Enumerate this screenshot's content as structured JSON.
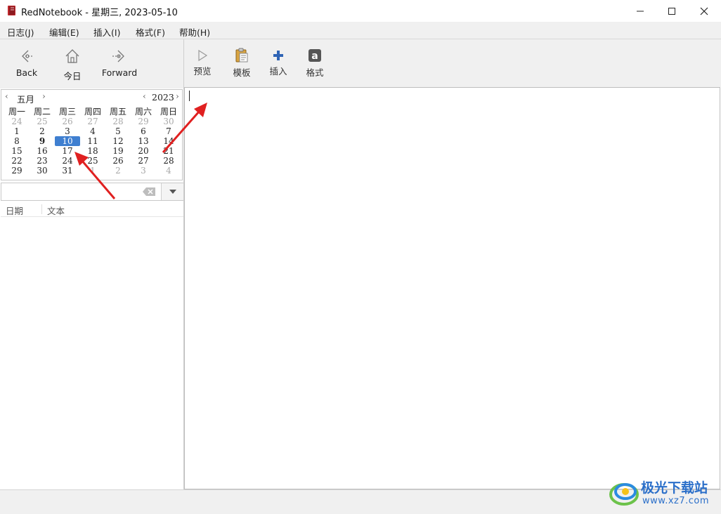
{
  "window": {
    "title": "RedNotebook - 星期三, 2023-05-10",
    "minimize_icon": "minimize-icon",
    "maximize_icon": "maximize-icon",
    "close_icon": "close-icon"
  },
  "menu": [
    {
      "label": "日志(J)"
    },
    {
      "label": "编辑(E)"
    },
    {
      "label": "插入(I)"
    },
    {
      "label": "格式(F)"
    },
    {
      "label": "帮助(H)"
    }
  ],
  "nav_toolbar": {
    "back": "Back",
    "today": "今日",
    "forward": "Forward"
  },
  "edit_toolbar": {
    "preview": "预览",
    "template": "模板",
    "insert": "插入",
    "format": "格式"
  },
  "calendar": {
    "month": "五月",
    "year": "2023",
    "weekdays": [
      "周一",
      "周二",
      "周三",
      "周四",
      "周五",
      "周六",
      "周日"
    ],
    "weeks": [
      [
        "24",
        "25",
        "26",
        "27",
        "28",
        "29",
        "30"
      ],
      [
        "1",
        "2",
        "3",
        "4",
        "5",
        "6",
        "7"
      ],
      [
        "8",
        "9",
        "10",
        "11",
        "12",
        "13",
        "14"
      ],
      [
        "15",
        "16",
        "17",
        "18",
        "19",
        "20",
        "21"
      ],
      [
        "22",
        "23",
        "24",
        "25",
        "26",
        "27",
        "28"
      ],
      [
        "29",
        "30",
        "31",
        "1",
        "2",
        "3",
        "4"
      ]
    ],
    "selected_day": "10",
    "marked_day": "9"
  },
  "search": {
    "value": "",
    "placeholder": ""
  },
  "results": {
    "col_date": "日期",
    "col_text": "文本"
  },
  "editor": {
    "content": ""
  },
  "watermark": {
    "name": "极光下载站",
    "url": "www.xz7.com"
  },
  "colors": {
    "selection": "#3f7fd0",
    "annotation_arrow": "#e02020",
    "app_icon": "#c0282d"
  }
}
